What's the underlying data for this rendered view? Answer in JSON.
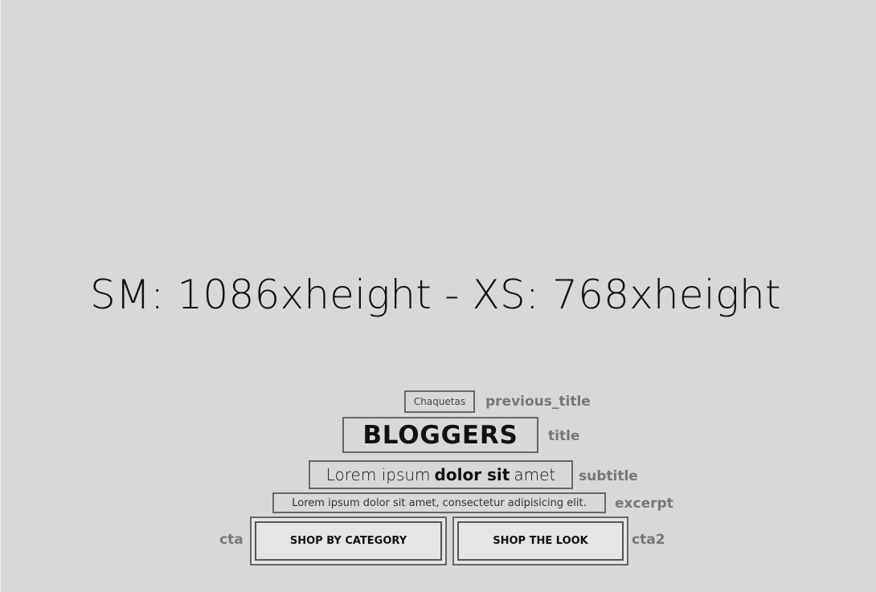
{
  "placeholder": {
    "size_note": "SM: 1086xheight - XS: 768xheight"
  },
  "hero": {
    "previous_title": {
      "text": "Chaquetas",
      "label": "previous_title"
    },
    "title": {
      "text": "BLOGGERS",
      "label": "title"
    },
    "subtitle": {
      "before": "Lorem ipsum",
      "bold": "dolor sit",
      "after": "amet",
      "label": "subtitle"
    },
    "excerpt": {
      "text": "Lorem ipsum dolor sit amet, consectetur adipisicing elit.",
      "label": "excerpt"
    },
    "cta": {
      "text": "SHOP BY CATEGORY",
      "label": "cta"
    },
    "cta2": {
      "text": "SHOP THE LOOK",
      "label": "cta2"
    }
  }
}
